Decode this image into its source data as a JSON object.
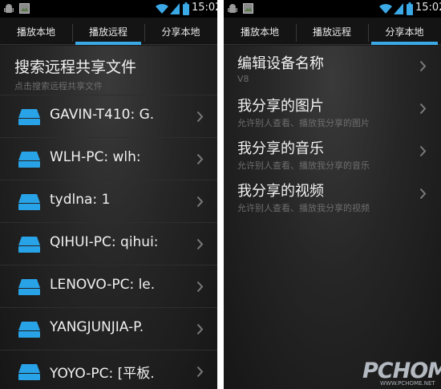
{
  "status_bar": {
    "time": "15:02"
  },
  "tabs": [
    {
      "label": "播放本地"
    },
    {
      "label": "播放远程"
    },
    {
      "label": "分享本地"
    }
  ],
  "left": {
    "active_tab": 1,
    "header_title": "搜索远程共享文件",
    "header_subtitle": "点击搜索远程共享文件",
    "devices": [
      {
        "label": "GAVIN-T410: G."
      },
      {
        "label": "WLH-PC: wlh:"
      },
      {
        "label": "tydlna: 1"
      },
      {
        "label": "QIHUI-PC: qihui:"
      },
      {
        "label": "LENOVO-PC: le."
      },
      {
        "label": "YANGJUNJIA-P."
      },
      {
        "label": "YOYO-PC: [平板."
      }
    ]
  },
  "right": {
    "active_tab": 2,
    "settings": [
      {
        "title": "编辑设备名称",
        "subtitle": "V8"
      },
      {
        "title": "我分享的图片",
        "subtitle": "允许别人查看、播放我分享的图片"
      },
      {
        "title": "我分享的音乐",
        "subtitle": "允许别人查看、播放我分享的音乐"
      },
      {
        "title": "我分享的视频",
        "subtitle": "允许别人查看、播放我分享的视频"
      }
    ]
  },
  "watermark": {
    "brand": "PCHOME",
    "url": "WWW.PCHOME.NET"
  },
  "colors": {
    "accent": "#3aa9e6",
    "drive_icon": "#29a3e8",
    "background": "#1b1b1b"
  },
  "icons": {
    "status_left": [
      "android-debug-icon",
      "image-notification-icon"
    ],
    "status_right": [
      "wifi-icon",
      "signal-icon",
      "battery-icon"
    ],
    "device": "drive-icon",
    "row_action": "chevron-right-icon"
  }
}
